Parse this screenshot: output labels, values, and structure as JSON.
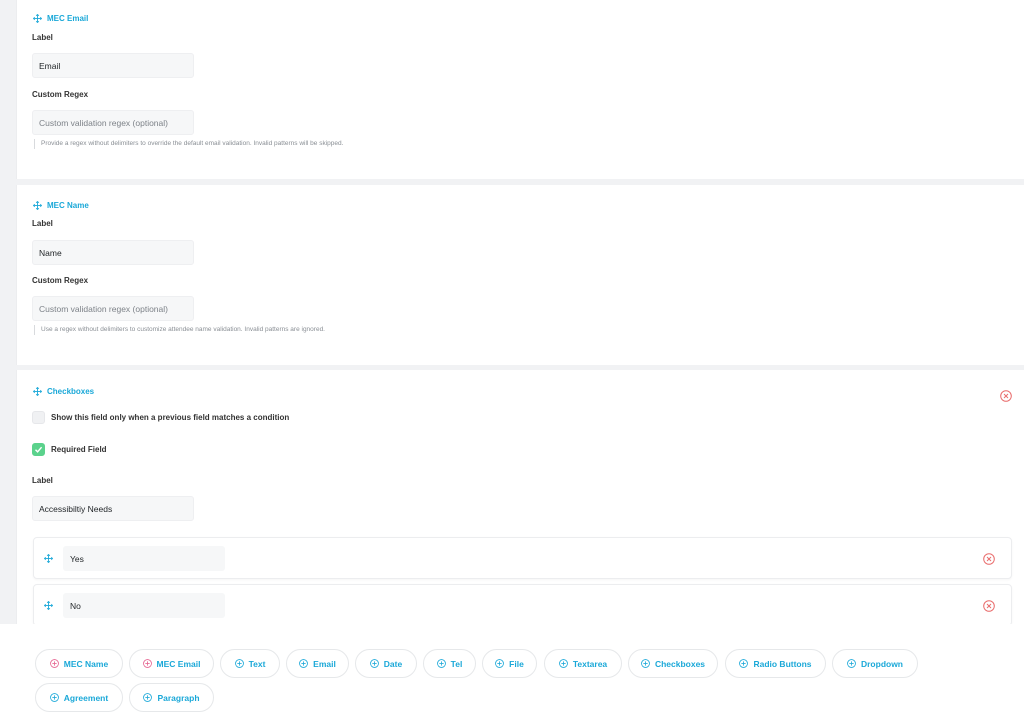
{
  "colors": {
    "accent": "#1aa8d8",
    "remove": "#e96d6d",
    "checked": "#5bd28c",
    "special_plus": "#e5628f"
  },
  "email_field": {
    "title": "MEC Email",
    "label_caption": "Label",
    "label_value": "Email",
    "regex_caption": "Custom Regex",
    "regex_placeholder": "Custom validation regex (optional)",
    "hint": "Provide a regex without delimiters to override the default email validation. Invalid patterns will be skipped."
  },
  "name_field": {
    "title": "MEC Name",
    "label_caption": "Label",
    "label_value": "Name",
    "regex_caption": "Custom Regex",
    "regex_placeholder": "Custom validation regex (optional)",
    "hint": "Use a regex without delimiters to customize attendee name validation. Invalid patterns are ignored."
  },
  "checkboxes_field": {
    "title": "Checkboxes",
    "condition_label": "Show this field only when a previous field matches a condition",
    "condition_checked": false,
    "required_label": "Required Field",
    "required_checked": true,
    "label_caption": "Label",
    "label_value": "Accessibiltiy Needs",
    "options": [
      {
        "value": "Yes"
      },
      {
        "value": "No"
      }
    ]
  },
  "add_buttons": [
    {
      "label": "MEC Name",
      "icon": "plus-circle-icon",
      "special": true
    },
    {
      "label": "MEC Email",
      "icon": "plus-circle-icon",
      "special": true
    },
    {
      "label": "Text",
      "icon": "plus-circle-icon",
      "special": false
    },
    {
      "label": "Email",
      "icon": "plus-circle-icon",
      "special": false
    },
    {
      "label": "Date",
      "icon": "plus-circle-icon",
      "special": false
    },
    {
      "label": "Tel",
      "icon": "plus-circle-icon",
      "special": false
    },
    {
      "label": "File",
      "icon": "plus-circle-icon",
      "special": false
    },
    {
      "label": "Textarea",
      "icon": "plus-circle-icon",
      "special": false
    },
    {
      "label": "Checkboxes",
      "icon": "plus-circle-icon",
      "special": false
    },
    {
      "label": "Radio Buttons",
      "icon": "plus-circle-icon",
      "special": false
    },
    {
      "label": "Dropdown",
      "icon": "plus-circle-icon",
      "special": false
    },
    {
      "label": "Agreement",
      "icon": "plus-circle-icon",
      "special": false
    },
    {
      "label": "Paragraph",
      "icon": "plus-circle-icon",
      "special": false
    }
  ]
}
